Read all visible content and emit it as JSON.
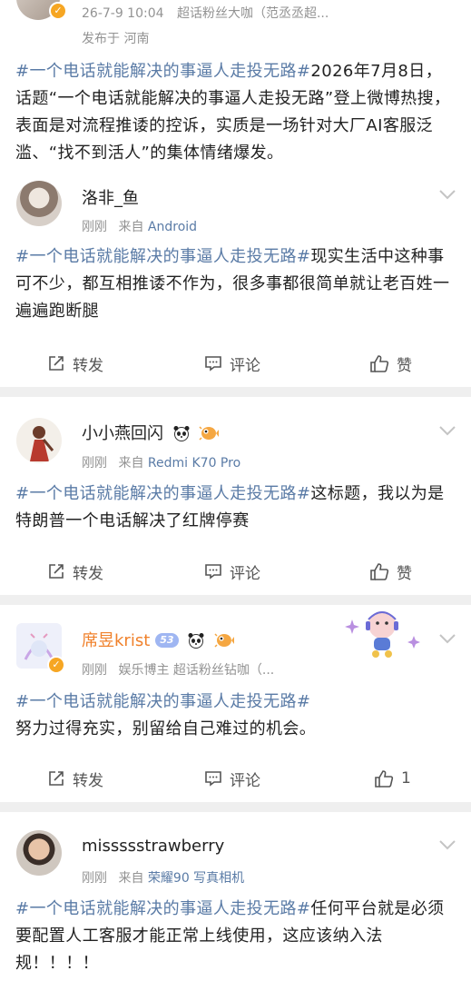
{
  "post": {
    "timestamp": "26-7-9 10:04",
    "group": "超话粉丝大咖（范丞丞超...",
    "location": "发布于 河南",
    "hashtag": "#一个电话就能解决的事逼人走投无路#",
    "text": "2026年7月8日，话题“一个电话就能解决的事逼人走投无路”登上微博热搜，表面是对流程推诿的控诉，实质是一场针对大厂AI客服泛滥、“找不到活人”的集体情绪爆发。"
  },
  "comments": [
    {
      "name": "洛非_鱼",
      "time": "刚刚",
      "source_prefix": "来自",
      "source": "Android",
      "hashtag": "#一个电话就能解决的事逼人走投无路#",
      "text": "现实生活中这种事可不少，都互相推诿不作为，很多事都很简单就让老百姓一遍遍跑断腿",
      "repost_label": "转发",
      "comment_label": "评论",
      "like_label": "赞"
    },
    {
      "name": "小小燕回闪",
      "time": "刚刚",
      "source_prefix": "来自",
      "source": "Redmi K70 Pro",
      "hashtag": "#一个电话就能解决的事逼人走投无路#",
      "text": "这标题，我以为是特朗普一个电话解决了红牌停赛",
      "repost_label": "转发",
      "comment_label": "评论",
      "like_label": "赞"
    },
    {
      "name": "席昱krist",
      "level_badge": "53",
      "time": "刚刚",
      "tags": "娱乐博主 超话粉丝钻咖（...",
      "hashtag": "#一个电话就能解决的事逼人走投无路#",
      "text": "努力过得充实，别留给自己难过的机会。",
      "repost_label": "转发",
      "comment_label": "评论",
      "like_count": "1"
    },
    {
      "name": "missssstrawberry",
      "time": "刚刚",
      "source_prefix": "来自",
      "source": "荣耀90 写真相机",
      "hashtag": "#一个电话就能解决的事逼人走投无路#",
      "text": "任何平台就是必须要配置人工客服才能正常上线使用，这应该纳入法规！！！！"
    }
  ],
  "colors": {
    "link": "#5a7ba6",
    "meta": "#939393",
    "separator": "#efefef",
    "vip": "#f6a623"
  },
  "icons": [
    "chevron-down-icon",
    "repost-icon",
    "comment-icon",
    "like-icon",
    "verified-badge-icon",
    "panda-emoji-icon",
    "pufferfish-emoji-icon"
  ]
}
